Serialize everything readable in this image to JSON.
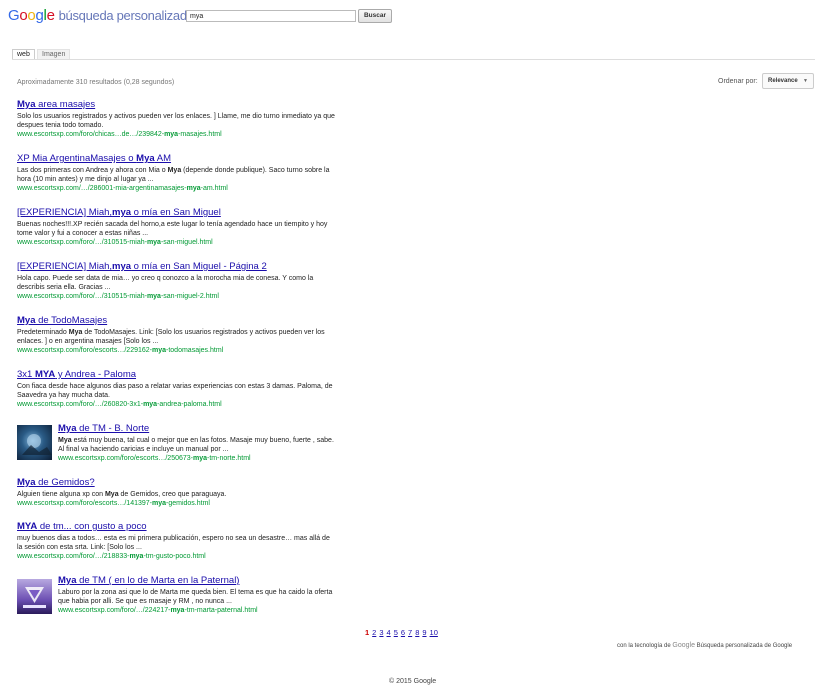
{
  "header": {
    "logo_letters": [
      {
        "ch": "G",
        "color": "#3369e8"
      },
      {
        "ch": "o",
        "color": "#d50f25"
      },
      {
        "ch": "o",
        "color": "#eeb211"
      },
      {
        "ch": "g",
        "color": "#3369e8"
      },
      {
        "ch": "l",
        "color": "#009925"
      },
      {
        "ch": "e",
        "color": "#d50f25"
      }
    ],
    "subtitle": "búsqueda personalizada",
    "query": "mya",
    "search_button": "Buscar"
  },
  "tabs": {
    "web": "web",
    "image": "Imagen"
  },
  "results_info": "Aproximadamente 310 resultados (0,28 segundos)",
  "sort": {
    "label": "Ordenar por:",
    "selected": "Relevance"
  },
  "results": [
    {
      "title_html": "<b>Mya</b> area masajes",
      "snippet_html": "Solo los usuarios registrados y activos pueden ver los enlaces. ] Llame, me dio turno inmediato ya que despues tenia todo tomado.",
      "url_html": "www.escortsxp.com/foro/chicas…de…/239842-<b>mya</b>-masajes.html"
    },
    {
      "title_html": "XP Mia ArgentinaMasajes o <b>Mya</b> AM",
      "snippet_html": "Las dos primeras con Andrea y ahora con Mia o <b>Mya</b> (depende donde publique). Saco turno sobre la hora (10 min antes) y me dinjo al lugar ya ...",
      "url_html": "www.escortsxp.com/…/286001-mia-argentinamasajes-<b>mya</b>-am.html"
    },
    {
      "title_html": "[EXPERIENCIA] Miah,<b>mya</b> o mía en San Miguel",
      "snippet_html": "Buenas noches!!!.XP recién sacada del horno,a este lugar lo tenía agendado hace un tiempito y hoy tome valor y fui a conocer a estas niñas ...",
      "url_html": "www.escortsxp.com/foro/…/310515-miah-<b>mya</b>-san-miguel.html"
    },
    {
      "title_html": "[EXPERIENCIA] Miah,<b>mya</b> o mía en San Miguel - Página 2",
      "snippet_html": "Hola capo. Puede ser data de mia… yo creo q conozco a la morocha mia de conesa. Y como la describis seria ella. Gracias ...",
      "url_html": "www.escortsxp.com/foro/…/310515-miah-<b>mya</b>-san-miguel-2.html"
    },
    {
      "title_html": "<b>Mya</b> de TodoMasajes",
      "snippet_html": "Predeterminado <b>Mya</b> de TodoMasajes. Link: [Solo los usuarios registrados y activos pueden ver los enlaces. ] o en argentina masajes [Solo los ...",
      "url_html": "www.escortsxp.com/foro/escorts…/229162-<b>mya</b>-todomasajes.html"
    },
    {
      "title_html": "3x1 <b>MYA</b> y Andrea - Paloma",
      "snippet_html": "Con fiaca desde hace algunos dias paso a relatar varias experiencias con estas 3 damas. Paloma, de Saavedra ya hay mucha data.",
      "url_html": "www.escortsxp.com/foro/…/260820-3x1-<b>mya</b>-andrea-paloma.html"
    },
    {
      "title_html": "<b>Mya</b> de TM - B. Norte",
      "snippet_html": "<b>Mya</b> está muy buena, tal cual o mejor que en las fotos. Masaje muy bueno, fuerte , sabe. Al final va haciendo caricias e incluye un manual por ...",
      "url_html": "www.escortsxp.com/foro/escorts…/250673-<b>mya</b>-tm-norte.html"
    },
    {
      "title_html": "<b>Mya</b> de Gemidos?",
      "snippet_html": "Alguien tiene alguna xp con <b>Mya</b> de Gemidos, creo que paraguaya.",
      "url_html": "www.escortsxp.com/foro/escorts…/141397-<b>mya</b>-gemidos.html"
    },
    {
      "title_html": "<b>MYA</b> de tm... con gusto a poco",
      "snippet_html": "muy buenos dias a todos… esta es mi primera publicación, espero no sea un desastre… mas allá de la sesión con esta srta. Link: [Solo los ...",
      "url_html": "www.escortsxp.com/foro/…/218833-<b>mya</b>-tm-gusto-poco.html"
    },
    {
      "title_html": "<b>Mya</b> de TM ( en lo de Marta en la Paternal)",
      "snippet_html": "Laburo por la zona asi que lo de Marta me queda bien. El tema es que ha caido la oferta que habia por alli. Se que es masaje y RM , no nunca ...",
      "url_html": "www.escortsxp.com/foro/…/224217-<b>mya</b>-tm-marta-paternal.html"
    }
  ],
  "pagination": {
    "current": "1",
    "pages": [
      "2",
      "3",
      "4",
      "5",
      "6",
      "7",
      "8",
      "9",
      "10"
    ]
  },
  "footer": {
    "powered_prefix": "con la tecnología de",
    "powered_google": "Google",
    "powered_suffix": "Búsqueda personalizada de Google",
    "copyright": "© 2015 Google"
  }
}
